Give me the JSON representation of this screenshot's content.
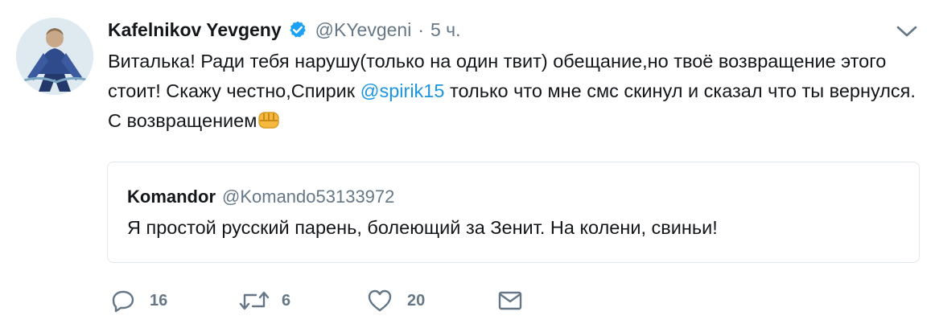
{
  "tweet": {
    "author_name": "Kafelnikov Yevgeny",
    "handle": "@KYevgeni",
    "separator": "·",
    "time": "5 ч.",
    "text_parts": {
      "before_mention": "Виталька! Ради тебя нарушу(только на один твит) обещание,но твоё возвращение этого стоит! Скажу честно,Спирик ",
      "mention": "@spirik15",
      "after_mention": " только что мне смс скинул и сказал что ты вернулся. С возвращением"
    },
    "emoji": "fist-emoji"
  },
  "quote": {
    "author_name": "Komandor",
    "handle": "@Komando53133972",
    "text": "Я простой русский парень, болеющий за Зенит. На колени, свиньи!"
  },
  "actions": {
    "reply_count": "16",
    "retweet_count": "6",
    "like_count": "20"
  },
  "colors": {
    "text": "#14171a",
    "secondary": "#657786",
    "link": "#1b95e0",
    "verified": "#1da1f2",
    "border": "#e1e8ed"
  },
  "icons": [
    "verified-badge-icon",
    "chevron-down-icon",
    "reply-icon",
    "retweet-icon",
    "like-icon",
    "direct-message-icon"
  ]
}
